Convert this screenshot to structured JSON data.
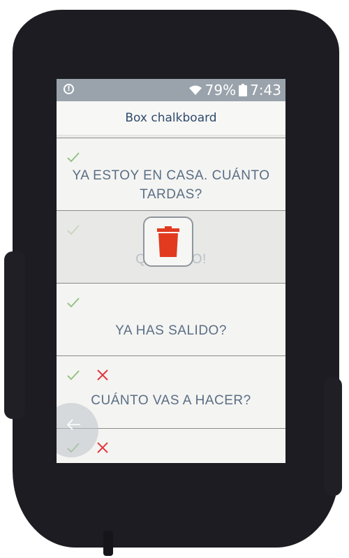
{
  "status_bar": {
    "alert_icon": "alert-circle-icon",
    "wifi_icon": "wifi-icon",
    "battery_percent": "79%",
    "battery_icon": "battery-icon",
    "time": "7:43"
  },
  "header": {
    "title": "Box chalkboard"
  },
  "messages": [
    {
      "text": "YA ESTOY EN CASA. CUÁNTO TARDAS?",
      "status_icons": [
        "check-icon"
      ]
    },
    {
      "text": "QUÉ FRÍO!",
      "status_icons": [
        "check-icon"
      ],
      "state": "being deleted"
    },
    {
      "text": "YA HAS SALIDO?",
      "status_icons": [
        "check-icon"
      ]
    },
    {
      "text": "CUÁNTO VAS A HACER?",
      "status_icons": [
        "check-icon",
        "cross-icon"
      ]
    },
    {
      "text": "",
      "status_icons": [
        "check-icon",
        "cross-icon"
      ]
    }
  ],
  "overlay": {
    "icon": "trash-icon"
  },
  "nav": {
    "back_icon": "back-arrow-icon"
  },
  "colors": {
    "status_bar": "#9aa3ab",
    "title_text": "#2f4a6d",
    "message_text": "#5a6e85",
    "check": "#8fbf7a",
    "cross": "#e0393e",
    "trash": "#e23a1f"
  }
}
